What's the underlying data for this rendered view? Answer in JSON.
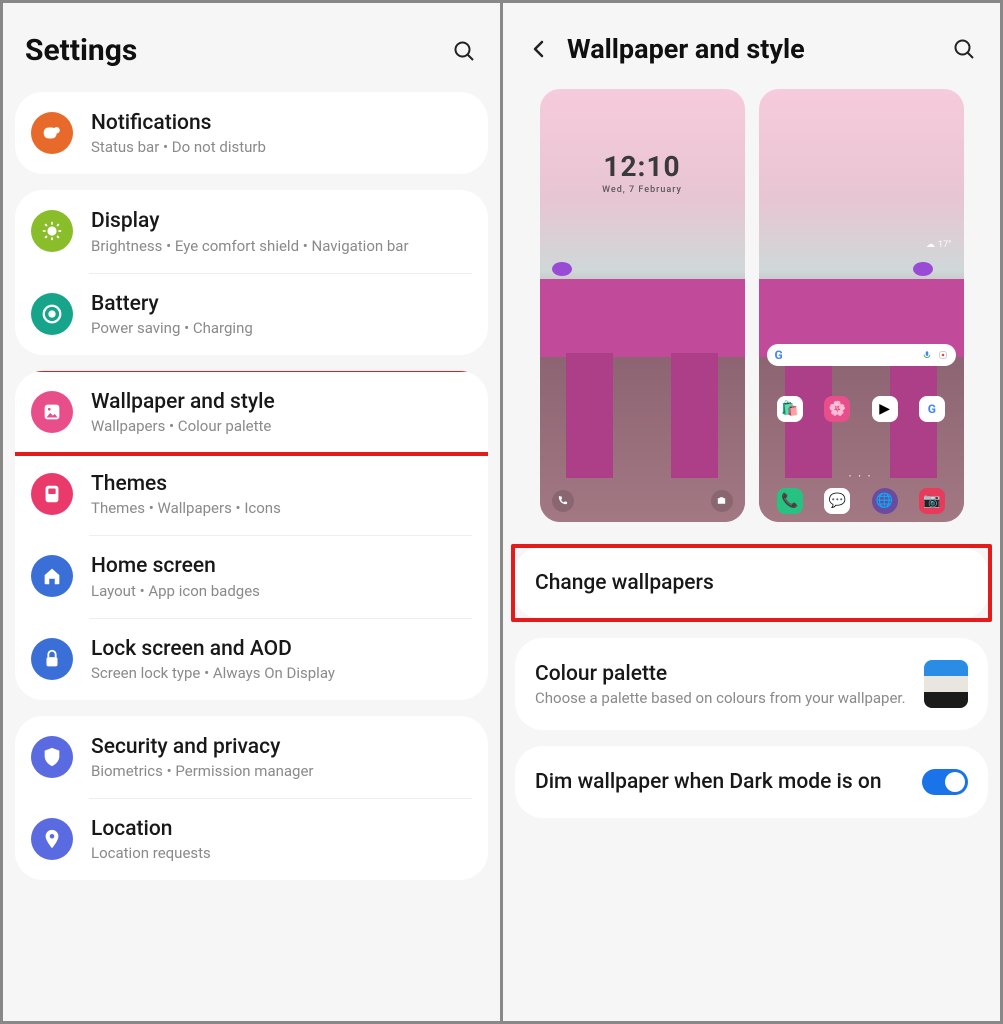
{
  "left": {
    "title": "Settings",
    "groups": [
      [
        {
          "key": "notifications",
          "title": "Notifications",
          "sub": "Status bar  •  Do not disturb",
          "color": "#e86a2b"
        }
      ],
      [
        {
          "key": "display",
          "title": "Display",
          "sub": "Brightness  •  Eye comfort shield  •  Navigation bar",
          "color": "#8abd2a"
        },
        {
          "key": "battery",
          "title": "Battery",
          "sub": "Power saving  •  Charging",
          "color": "#16a58a"
        }
      ],
      [
        {
          "key": "wallpaper",
          "title": "Wallpaper and style",
          "sub": "Wallpapers  •  Colour palette",
          "color": "#e84e8a",
          "highlight": true
        },
        {
          "key": "themes",
          "title": "Themes",
          "sub": "Themes  •  Wallpapers  •  Icons",
          "color": "#ea3a6b"
        },
        {
          "key": "home",
          "title": "Home screen",
          "sub": "Layout  •  App icon badges",
          "color": "#3b6fd8"
        },
        {
          "key": "lock",
          "title": "Lock screen and AOD",
          "sub": "Screen lock type  •  Always On Display",
          "color": "#3b6fd8"
        }
      ],
      [
        {
          "key": "security",
          "title": "Security and privacy",
          "sub": "Biometrics  •  Permission manager",
          "color": "#5a6ae0"
        },
        {
          "key": "location",
          "title": "Location",
          "sub": "Location requests",
          "color": "#5a6ae0"
        }
      ]
    ]
  },
  "right": {
    "title": "Wallpaper and style",
    "lock_time": "12:10",
    "lock_date": "Wed, 7 February",
    "weather_temp": "17°",
    "change_label": "Change wallpapers",
    "palette": {
      "title": "Colour palette",
      "sub": "Choose a palette based on colours from your wallpaper.",
      "colors": [
        "#2b8ce6",
        "#e9e6e0",
        "#1b1b1b"
      ]
    },
    "dim": {
      "title": "Dim wallpaper when Dark mode is on",
      "on": true
    }
  }
}
